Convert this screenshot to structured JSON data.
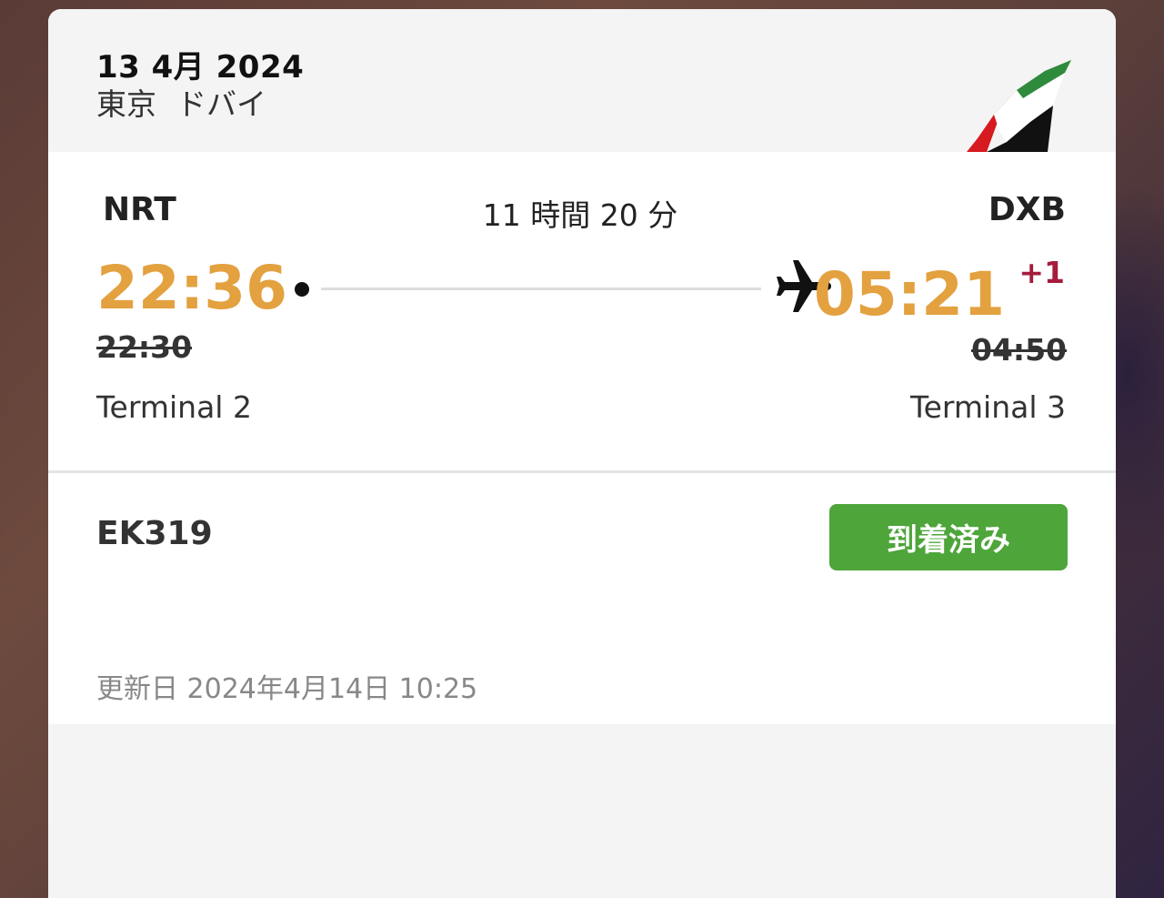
{
  "header": {
    "date": "13 4月 2024",
    "origin_city": "東京",
    "destination_city": "ドバイ",
    "airline_logo": "emirates-flag-logo"
  },
  "route": {
    "origin_code": "NRT",
    "destination_code": "DXB",
    "duration": "11 時間 20 分",
    "departure_time": "22:36",
    "departure_scheduled": "22:30",
    "arrival_time": "05:21",
    "arrival_day_offset": "+1",
    "arrival_scheduled": "04:50",
    "departure_terminal": "Terminal 2",
    "arrival_terminal": "Terminal 3",
    "plane_icon": "airplane-icon"
  },
  "flight": {
    "number": "EK319",
    "status": "到着済み",
    "updated": "更新日 2024年4月14日 10:25"
  },
  "colors": {
    "time_accent": "#e3a13f",
    "day_offset": "#a51c3c",
    "status_green": "#4ea53a",
    "header_bg": "#f4f4f4"
  }
}
